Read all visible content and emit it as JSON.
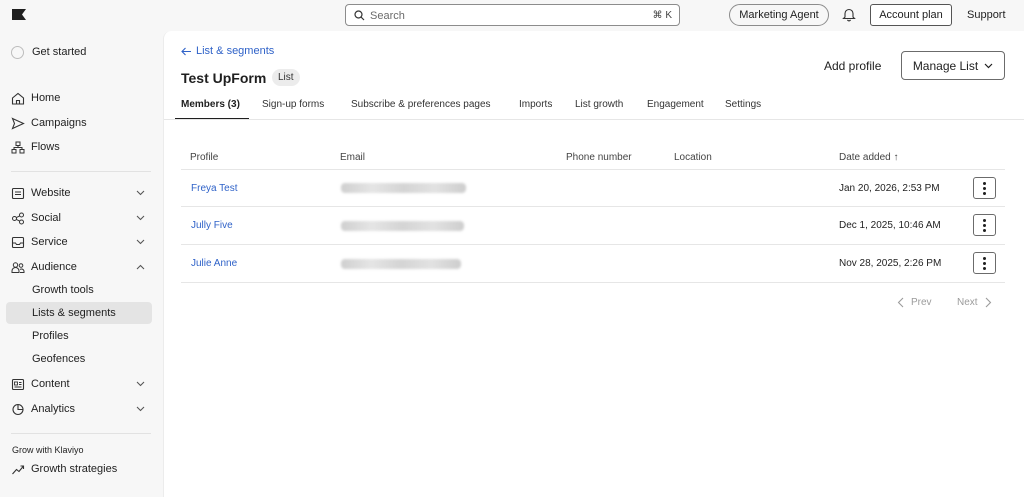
{
  "topbar": {
    "search_placeholder": "Search",
    "search_shortcut": "⌘ K",
    "agent_label": "Marketing Agent",
    "account_label": "Account plan",
    "support_label": "Support"
  },
  "sidebar": {
    "get_started": "Get started",
    "primary": [
      {
        "label": "Home",
        "icon": "home-icon"
      },
      {
        "label": "Campaigns",
        "icon": "send-icon"
      },
      {
        "label": "Flows",
        "icon": "flows-icon"
      }
    ],
    "groups": [
      {
        "label": "Website",
        "icon": "website-icon",
        "expanded": false
      },
      {
        "label": "Social",
        "icon": "social-icon",
        "expanded": false
      },
      {
        "label": "Service",
        "icon": "service-icon",
        "expanded": false
      },
      {
        "label": "Audience",
        "icon": "audience-icon",
        "expanded": true
      },
      {
        "label": "Content",
        "icon": "content-icon",
        "expanded": false
      },
      {
        "label": "Analytics",
        "icon": "analytics-icon",
        "expanded": false
      }
    ],
    "audience_items": [
      {
        "label": "Growth tools",
        "active": false
      },
      {
        "label": "Lists & segments",
        "active": true
      },
      {
        "label": "Profiles",
        "active": false
      },
      {
        "label": "Geofences",
        "active": false
      }
    ],
    "grow_heading": "Grow with Klaviyo",
    "grow_item": "Growth strategies"
  },
  "page": {
    "back_label": "List & segments",
    "title": "Test UpForm",
    "badge": "List",
    "add_profile": "Add profile",
    "manage_list": "Manage List",
    "tabs": [
      {
        "label": "Members (3)",
        "active": true
      },
      {
        "label": "Sign-up forms",
        "active": false
      },
      {
        "label": "Subscribe & preferences pages",
        "active": false
      },
      {
        "label": "Imports",
        "active": false
      },
      {
        "label": "List growth",
        "active": false
      },
      {
        "label": "Engagement",
        "active": false
      },
      {
        "label": "Settings",
        "active": false
      }
    ]
  },
  "table": {
    "columns": [
      "Profile",
      "Email",
      "Phone number",
      "Location",
      "Date added ↑"
    ],
    "rows": [
      {
        "profile": "Freya Test",
        "date": "Jan 20, 2026, 2:53 PM"
      },
      {
        "profile": "Jully Five",
        "date": "Dec 1, 2025, 10:46 AM"
      },
      {
        "profile": "Julie Anne",
        "date": "Nov 28, 2025, 2:26 PM"
      }
    ]
  },
  "pager": {
    "prev": "Prev",
    "next": "Next"
  },
  "colors": {
    "link": "#2f62c8",
    "active_nav_bg": "#e4e4e4",
    "background": "#f7f7f7"
  }
}
